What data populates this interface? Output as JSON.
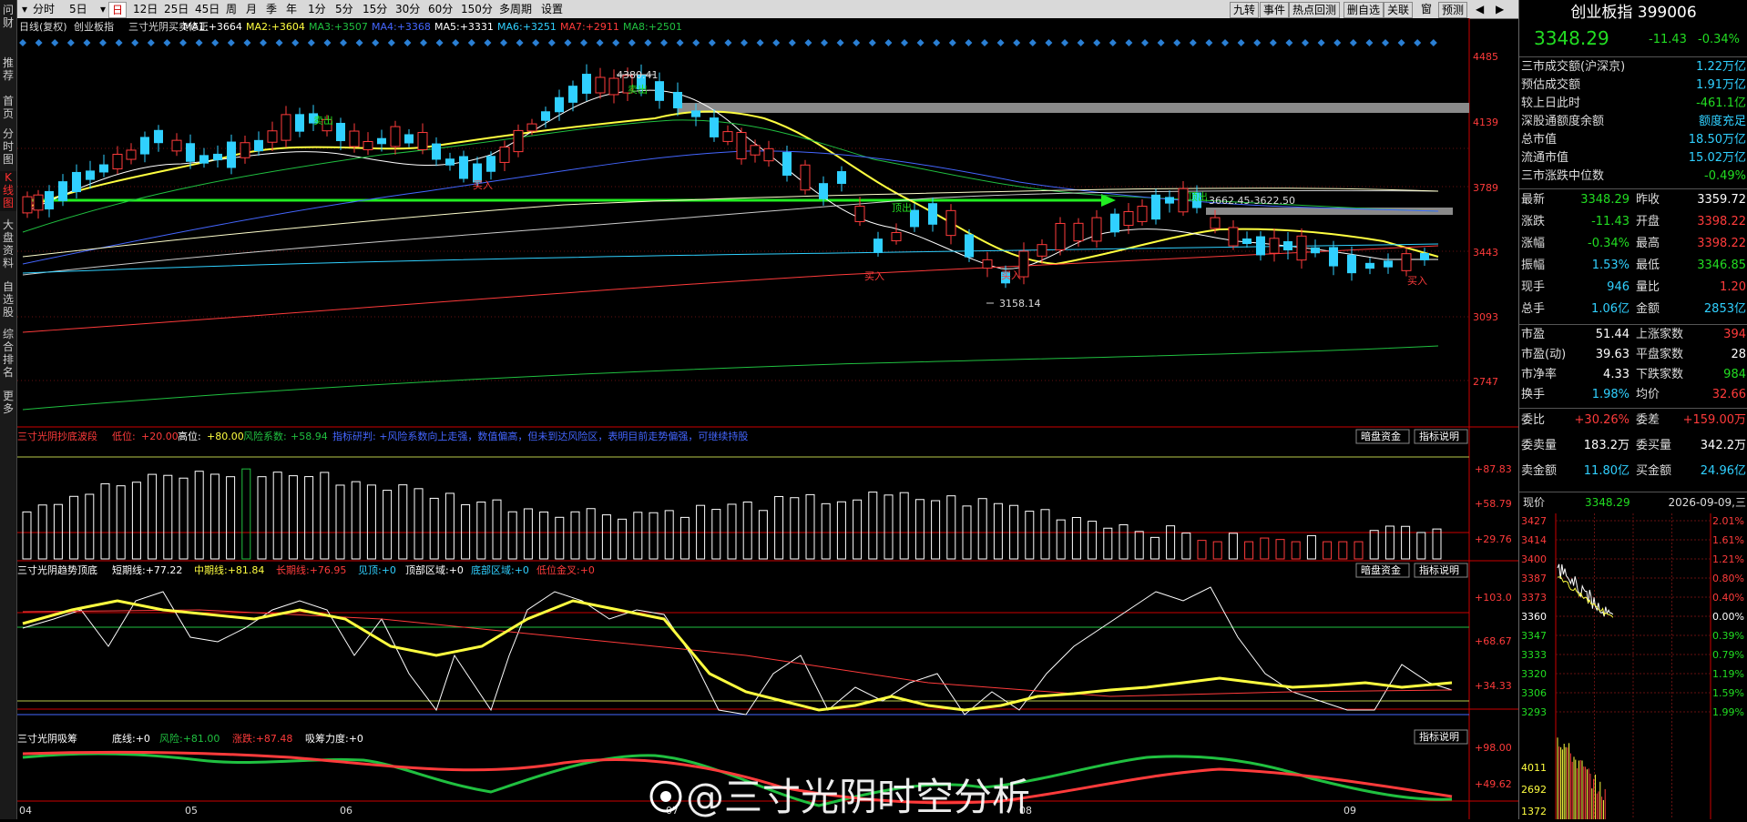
{
  "leftnav": [
    {
      "label": "问财",
      "active": false
    },
    {
      "label": "推荐",
      "active": false
    },
    {
      "label": "首页",
      "active": false
    },
    {
      "label": "分时图",
      "active": false
    },
    {
      "label": "K线图",
      "active": true
    },
    {
      "label": "大盘资料",
      "active": false
    },
    {
      "label": "自选股",
      "active": false
    },
    {
      "label": "综合排名",
      "active": false
    },
    {
      "label": "更多",
      "active": false
    }
  ],
  "toolbar": {
    "periods": [
      "分时",
      "5日",
      "日",
      "12日",
      "25日",
      "45日",
      "周",
      "月",
      "季",
      "年",
      "1分",
      "5分",
      "15分",
      "30分",
      "60分",
      "150分",
      "多周期",
      "设置"
    ],
    "active_period": "日",
    "right_buttons": [
      "九转",
      "事件",
      "热点回测",
      "删自选",
      "关联",
      "预测"
    ],
    "right_icons": [
      "undo-icon",
      "crosshair-icon",
      "refresh-icon",
      "hand-icon",
      "forward-icon",
      "back-icon",
      "zoom-in-icon",
      "zoom-out-icon"
    ]
  },
  "main_legend": {
    "prefix": "日线(复权)",
    "name": "创业板指",
    "indicator": "三寸光阴买卖修正",
    "mas": [
      {
        "label": "MA1:",
        "value": "+3664",
        "color": "#ffffff"
      },
      {
        "label": "MA2:",
        "value": "+3604",
        "color": "#ffff40"
      },
      {
        "label": "MA3:",
        "value": "+3507",
        "color": "#20c040"
      },
      {
        "label": "MA4:",
        "value": "+3368",
        "color": "#4466ff"
      },
      {
        "label": "MA5:",
        "value": "+3331",
        "color": "#ffffff"
      },
      {
        "label": "MA6:",
        "value": "+3251",
        "color": "#30d0ff"
      },
      {
        "label": "MA7:",
        "value": "+2911",
        "color": "#ff3b3b"
      },
      {
        "label": "MA8:",
        "value": "+2501",
        "color": "#20c040"
      }
    ]
  },
  "price_axis": [
    "4485",
    "4139",
    "3789",
    "3443",
    "3093",
    "2747"
  ],
  "annotations": {
    "high_label": "4380.41",
    "low_label": "3158.14",
    "range_label": "3662.45-3622.50",
    "buy_label": "买入",
    "sell_label": "卖出",
    "top_label": "顶出"
  },
  "x_axis": [
    "04",
    "05",
    "06",
    "07",
    "08",
    "09"
  ],
  "panel1": {
    "title": "三寸光阴抄底波段",
    "low_label": "低位:",
    "low_value": "+20.00",
    "high_label": "高位:",
    "high_value": "+80.00",
    "risk_label": "风险系数:",
    "risk_value": "+58.94",
    "comment": "指标研判: +风险系数向上走强，数值偏高，但未到达风险区，表明目前走势偏强，可继续持股",
    "axis": [
      "+87.83",
      "+58.79",
      "+29.76"
    ],
    "btn1": "暗盘资金",
    "btn2": "指标说明"
  },
  "panel2": {
    "title": "三寸光阴趋势顶底",
    "items": [
      {
        "label": "短期线:",
        "value": "+77.22",
        "color": "#ffffff"
      },
      {
        "label": "中期线:",
        "value": "+81.84",
        "color": "#ffff40"
      },
      {
        "label": "长期线:",
        "value": "+76.95",
        "color": "#ff3b3b"
      },
      {
        "label": "见顶:",
        "value": "+0",
        "color": "#30d0ff"
      },
      {
        "label": "顶部区域:",
        "value": "+0",
        "color": "#ffffff"
      },
      {
        "label": "底部区域:",
        "value": "+0",
        "color": "#30d0ff"
      },
      {
        "label": "低位金叉:",
        "value": "+0",
        "color": "#ff3b3b"
      }
    ],
    "axis": [
      "+103.0",
      "+68.67",
      "+34.33"
    ],
    "btn1": "暗盘资金",
    "btn2": "指标说明"
  },
  "panel3": {
    "title": "三寸光阴吸筹",
    "items": [
      {
        "label": "底线:",
        "value": "+0",
        "color": "#ffffff"
      },
      {
        "label": "风险:",
        "value": "+81.00",
        "color": "#20c040"
      },
      {
        "label": "涨跌:",
        "value": "+87.48",
        "color": "#ff3b3b"
      },
      {
        "label": "吸筹力度:",
        "value": "+0",
        "color": "#ffffff"
      }
    ],
    "axis": [
      "+98.00",
      "+49.62"
    ],
    "btn2": "指标说明"
  },
  "watermark": "@三寸光阴时空分析",
  "right": {
    "title": "创业板指 399006",
    "price": "3348.29",
    "change": "-11.43",
    "change_pct": "-0.34%",
    "market_rows": [
      {
        "label": "三市成交额(沪深京)",
        "value": "1.22万亿",
        "color": "#30d0ff"
      },
      {
        "label": "预估成交额",
        "value": "1.91万亿",
        "color": "#30d0ff"
      },
      {
        "label": "较上日此时",
        "value": "-461.1亿",
        "color": "#22dd22"
      },
      {
        "label": "深股通额度余额",
        "value": "额度充足",
        "color": "#30d0ff"
      },
      {
        "label": "总市值",
        "value": "18.50万亿",
        "color": "#30d0ff"
      },
      {
        "label": "流通市值",
        "value": "15.02万亿",
        "color": "#30d0ff"
      },
      {
        "label": "三市涨跌中位数",
        "value": "-0.49%",
        "color": "#22dd22"
      }
    ],
    "quote_rows": [
      {
        "l1": "最新",
        "v1": "3348.29",
        "c1": "#22dd22",
        "l2": "昨收",
        "v2": "3359.72",
        "c2": "#ffffff"
      },
      {
        "l1": "涨跌",
        "v1": "-11.43",
        "c1": "#22dd22",
        "l2": "开盘",
        "v2": "3398.22",
        "c2": "#ff3b3b"
      },
      {
        "l1": "涨幅",
        "v1": "-0.34%",
        "c1": "#22dd22",
        "l2": "最高",
        "v2": "3398.22",
        "c2": "#ff3b3b"
      },
      {
        "l1": "振幅",
        "v1": "1.53%",
        "c1": "#30d0ff",
        "l2": "最低",
        "v2": "3346.85",
        "c2": "#22dd22"
      },
      {
        "l1": "现手",
        "v1": "946",
        "c1": "#30d0ff",
        "l2": "量比",
        "v2": "1.20",
        "c2": "#ff3b3b"
      },
      {
        "l1": "总手",
        "v1": "1.06亿",
        "c1": "#30d0ff",
        "l2": "金额",
        "v2": "2853亿",
        "c2": "#30d0ff"
      }
    ],
    "stat_rows": [
      {
        "l1": "市盈",
        "v1": "51.44",
        "c1": "#ffffff",
        "l2": "上涨家数",
        "v2": "394",
        "c2": "#ff3b3b"
      },
      {
        "l1": "市盈(动)",
        "v1": "39.63",
        "c1": "#ffffff",
        "l2": "平盘家数",
        "v2": "28",
        "c2": "#ffffff"
      },
      {
        "l1": "市净率",
        "v1": "4.33",
        "c1": "#ffffff",
        "l2": "下跌家数",
        "v2": "984",
        "c2": "#22dd22"
      },
      {
        "l1": "换手",
        "v1": "1.98%",
        "c1": "#30d0ff",
        "l2": "均价",
        "v2": "32.66",
        "c2": "#ff3b3b"
      }
    ],
    "order_rows": [
      {
        "l1": "委比",
        "v1": "+30.26%",
        "c1": "#ff3b3b",
        "l2": "委差",
        "v2": "+159.00万",
        "c2": "#ff3b3b"
      },
      {
        "l1": "委卖量",
        "v1": "183.2万",
        "c1": "#ffffff",
        "l2": "委买量",
        "v2": "342.2万",
        "c2": "#ffffff"
      },
      {
        "l1": "卖金额",
        "v1": "11.80亿",
        "c1": "#30d0ff",
        "l2": "买金额",
        "v2": "24.96亿",
        "c2": "#30d0ff"
      }
    ],
    "intraday": {
      "label": "现价",
      "price": "3348.29",
      "date": "2026-09-09,三",
      "left_axis": [
        "3427",
        "3414",
        "3400",
        "3387",
        "3373",
        "3360",
        "3347",
        "3333",
        "3320",
        "3306",
        "3293"
      ],
      "right_axis": [
        "2.01%",
        "1.61%",
        "1.21%",
        "0.80%",
        "0.40%",
        "0.00%",
        "0.39%",
        "0.79%",
        "1.19%",
        "1.59%",
        "1.99%"
      ],
      "vol_axis": [
        "4011",
        "2692",
        "1372"
      ]
    }
  }
}
